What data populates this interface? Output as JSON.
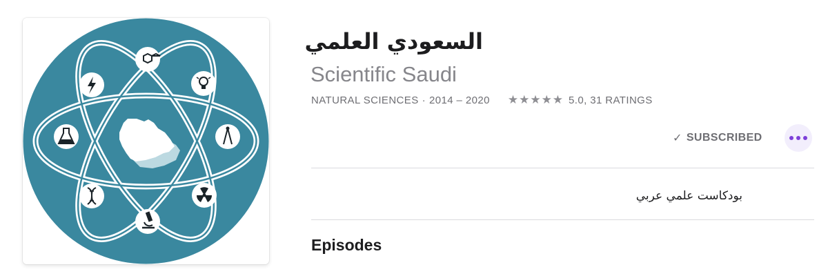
{
  "podcast": {
    "title_arabic": "السعودي العلمي",
    "title_english": "Scientific Saudi",
    "category": "NATURAL SCIENCES",
    "separator": "·",
    "years": "2014 – 2020",
    "stars": "★★★★★",
    "rating_text": "5.0, 31 RATINGS",
    "star_rating": 5.0,
    "description": "بودكاست علمي عربي"
  },
  "actions": {
    "subscribed_check": "✓",
    "subscribed_label": "SUBSCRIBED",
    "more_icon": "ellipsis-icon"
  },
  "sections": {
    "episodes_heading": "Episodes"
  },
  "artwork": {
    "background_color": "#3a889f",
    "orbit_color": "#ffffff",
    "node_color": "#1a2328",
    "map_color": "#ffffff",
    "map_shadow_color": "#bcd9e1",
    "icons": [
      "hexagon-molecule-icon",
      "lightbulb-icon",
      "lightning-icon",
      "compass-icon",
      "flask-icon",
      "radiation-icon",
      "dna-icon",
      "microscope-icon"
    ]
  },
  "colors": {
    "accent": "#7d3fd9",
    "secondary_text": "#86868b",
    "primary_text": "#1d1d1f"
  }
}
